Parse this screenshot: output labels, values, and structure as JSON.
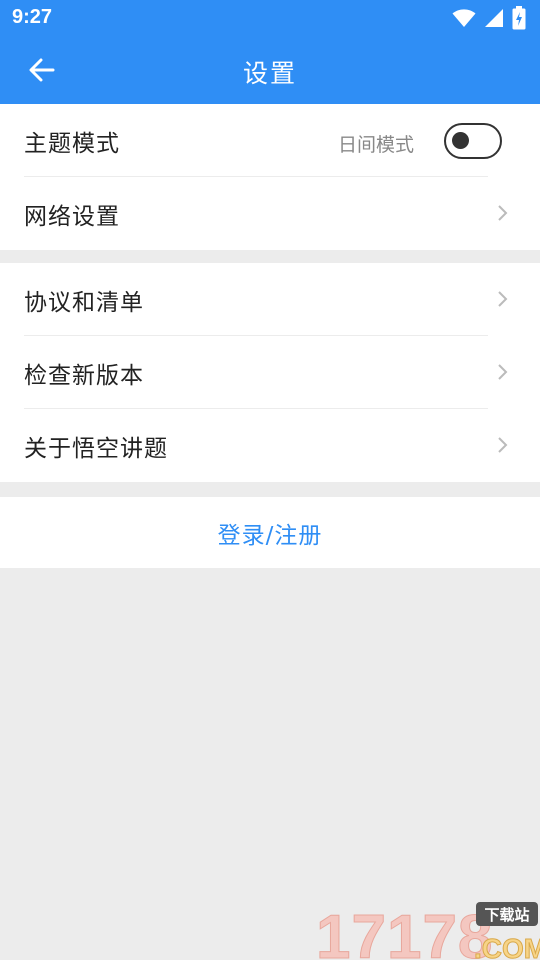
{
  "status_bar": {
    "time": "9:27"
  },
  "app_bar": {
    "title": "设置"
  },
  "group1": {
    "theme_label": "主题模式",
    "theme_value": "日间模式",
    "theme_dark_enabled": false,
    "network_label": "网络设置"
  },
  "group2": {
    "items": [
      {
        "label": "协议和清单"
      },
      {
        "label": "检查新版本"
      },
      {
        "label": "关于悟空讲题"
      }
    ]
  },
  "login": {
    "label": "登录/注册"
  },
  "watermark": {
    "text": "17178",
    "sub": ".COM",
    "badge": "下载站"
  },
  "colors": {
    "primary": "#2f8ef5",
    "background": "#ececec",
    "text": "#222222",
    "secondary_text": "#888888"
  }
}
